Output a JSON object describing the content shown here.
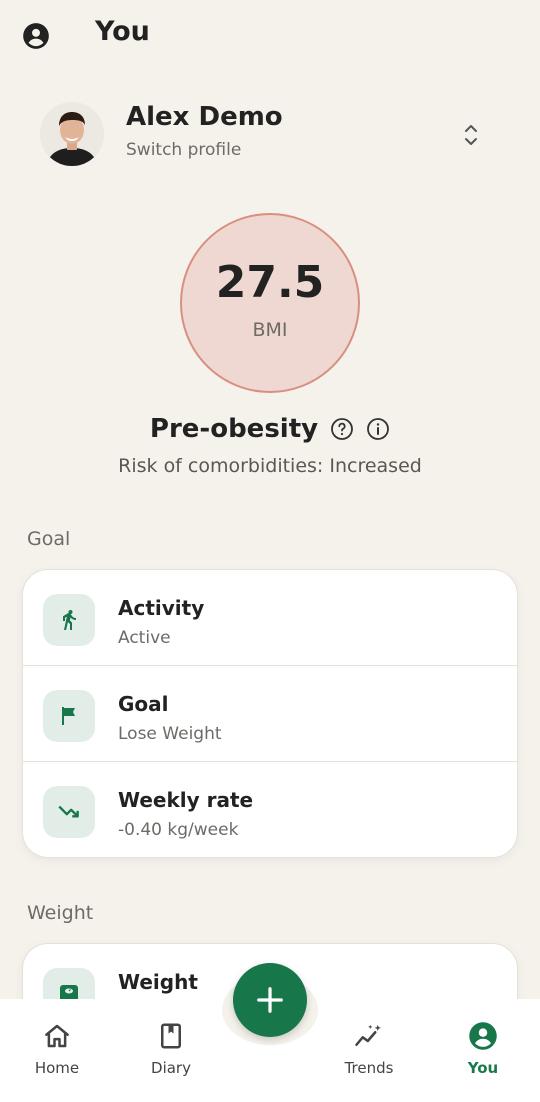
{
  "header": {
    "title": "You",
    "icon": "account-circle-icon"
  },
  "profile": {
    "name": "Alex Demo",
    "subtitle": "Switch profile"
  },
  "bmi": {
    "value": "27.5",
    "label": "BMI",
    "category": "Pre-obesity",
    "risk": "Risk of comorbidities: Increased"
  },
  "sections": {
    "goal": {
      "label": "Goal",
      "rows": [
        {
          "title": "Activity",
          "value": "Active",
          "icon": "walking-person-icon"
        },
        {
          "title": "Goal",
          "value": "Lose Weight",
          "icon": "flag-icon"
        },
        {
          "title": "Weekly rate",
          "value": "-0.40 kg/week",
          "icon": "trending-down-icon"
        }
      ]
    },
    "weight": {
      "label": "Weight",
      "rows": [
        {
          "title": "Weight",
          "icon": "scale-icon"
        }
      ]
    }
  },
  "nav": {
    "items": [
      {
        "label": "Home",
        "icon": "home-icon"
      },
      {
        "label": "Diary",
        "icon": "diary-book-icon"
      },
      {
        "label": "Trends",
        "icon": "trends-sparkle-icon"
      },
      {
        "label": "You",
        "icon": "account-circle-icon"
      }
    ],
    "fab_icon": "plus-icon"
  },
  "colors": {
    "accent": "#17764a",
    "bmi_fill": "#efd8d2",
    "bmi_border": "#d98f80",
    "background": "#f5f2ec"
  }
}
